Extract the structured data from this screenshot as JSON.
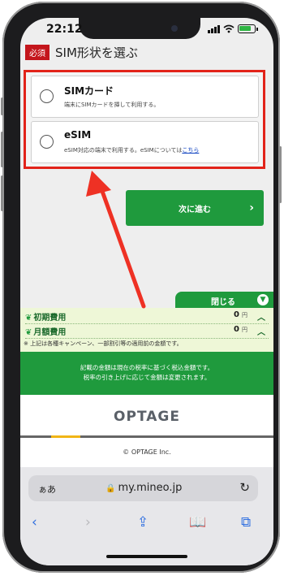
{
  "status_bar": {
    "time": "22:12"
  },
  "section": {
    "required_badge": "必須",
    "title": "SIM形状を選ぶ"
  },
  "options": [
    {
      "title": "SIMカード",
      "desc": "端末にSIMカードを挿して利用する。"
    },
    {
      "title": "eSIM",
      "desc": "eSIM対応の端末で利用する。eSIMについては",
      "link": "こちら"
    }
  ],
  "next_button": {
    "label": "次に進む"
  },
  "fee_panel": {
    "close_label": "閉じる",
    "rows": [
      {
        "label": "初期費用",
        "amount": "0",
        "unit": "円"
      },
      {
        "label": "月額費用",
        "amount": "0",
        "unit": "円"
      }
    ],
    "note": "※ 上記は各種キャンペーン、一部割引等の適用前の金額です。"
  },
  "tax_notice": {
    "line1": "記載の金額は現在の税率に基づく税込金額です。",
    "line2": "税率の引き上げに応じて金額は変更されます。"
  },
  "footer": {
    "brand": "OPTAGE",
    "copyright": "© OPTAGE Inc."
  },
  "browser": {
    "aa": "ぁあ",
    "url": "my.mineo.jp"
  },
  "colors": {
    "brand_green": "#1f9a3d",
    "highlight_red": "#e2231a",
    "required_red": "#c4161c"
  },
  "icons": [
    "signal-icon",
    "wifi-icon",
    "battery-icon",
    "chevron-right-icon",
    "chevron-down-icon",
    "chevron-up-icon",
    "leaf-icon",
    "lock-icon",
    "reload-icon",
    "back-icon",
    "forward-icon",
    "share-icon",
    "bookmarks-icon",
    "tabs-icon",
    "annotation-arrow"
  ]
}
